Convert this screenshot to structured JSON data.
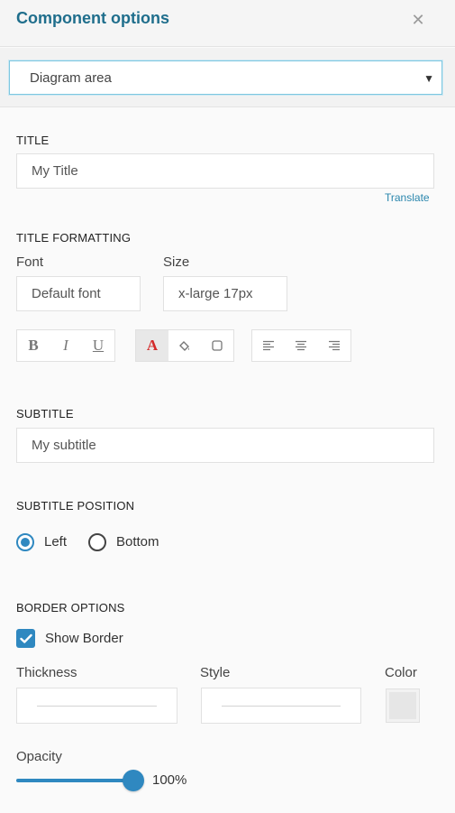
{
  "header": {
    "title": "Component options",
    "close_icon": "close-icon"
  },
  "component_select": {
    "value": "Diagram area"
  },
  "title_section": {
    "label": "TITLE",
    "value": "My Title",
    "translate_link": "Translate"
  },
  "title_formatting": {
    "label": "TITLE FORMATTING",
    "font_label": "Font",
    "font_value": "Default font",
    "size_label": "Size",
    "size_value": "x-large 17px",
    "text_style_buttons": [
      {
        "glyph": "B",
        "name": "bold"
      },
      {
        "glyph": "I",
        "name": "italic"
      },
      {
        "glyph": "U",
        "name": "underline"
      }
    ],
    "color_buttons": [
      {
        "glyph": "A",
        "name": "font-color",
        "active": true,
        "color": "#d42a2a"
      },
      {
        "icon": "paint-bucket-icon",
        "name": "fill-color"
      },
      {
        "icon": "border-icon",
        "name": "border-color"
      }
    ],
    "align_buttons": [
      {
        "icon": "align-left-icon"
      },
      {
        "icon": "align-center-icon"
      },
      {
        "icon": "align-right-icon"
      }
    ]
  },
  "subtitle_section": {
    "label": "SUBTITLE",
    "value": "My subtitle"
  },
  "subtitle_position": {
    "label": "SUBTITLE POSITION",
    "options": [
      {
        "label": "Left",
        "checked": true
      },
      {
        "label": "Bottom",
        "checked": false
      }
    ]
  },
  "border_options": {
    "label": "BORDER OPTIONS",
    "show_border_label": "Show Border",
    "show_border_checked": true,
    "thickness_label": "Thickness",
    "style_label": "Style",
    "color_label": "Color"
  },
  "opacity": {
    "label": "Opacity",
    "value_text": "100%",
    "fraction": 1.0
  },
  "colors": {
    "accent": "#2f88c0",
    "title": "#1f6e8c",
    "link": "#2a86ad"
  }
}
